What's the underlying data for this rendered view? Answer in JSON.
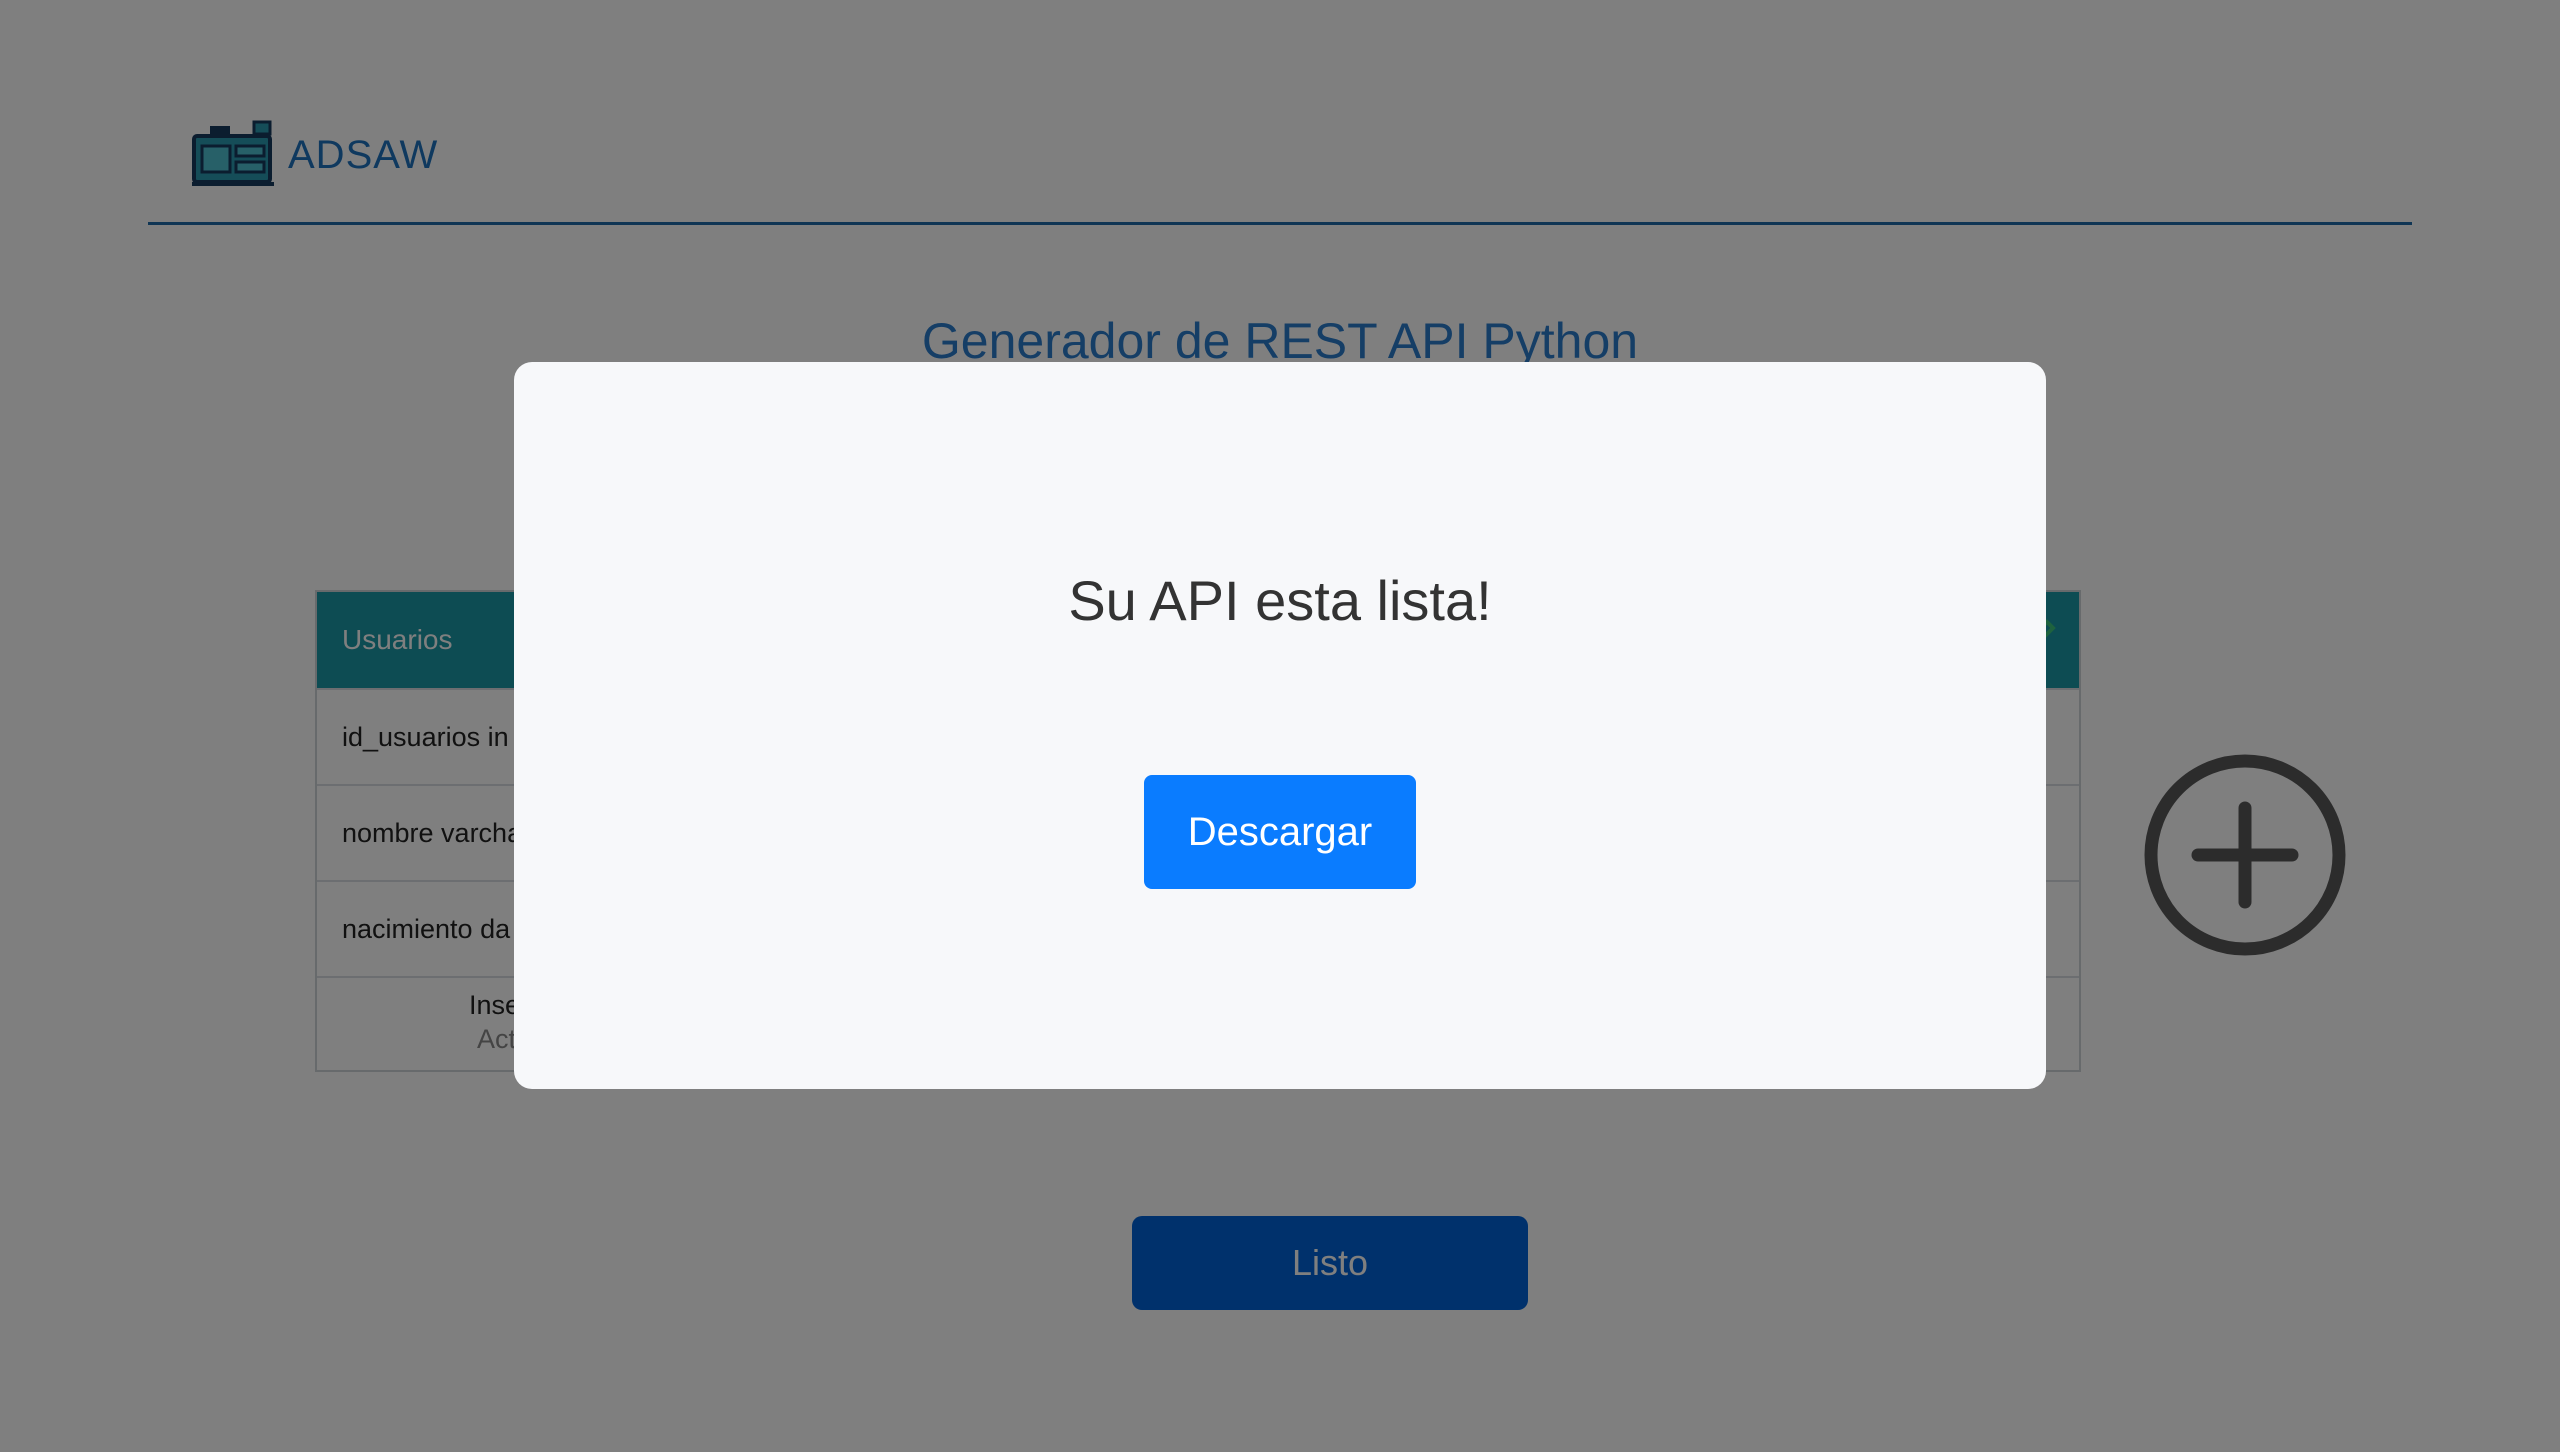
{
  "header": {
    "brand": "ADSAW",
    "logo_icon": "server-icon"
  },
  "main": {
    "title": "Generador de REST API Python",
    "table": {
      "name": "Usuarios",
      "header_icon": "edit-icon",
      "rows": [
        "id_usuarios in",
        "nombre varcha",
        "nacimiento da"
      ],
      "footer_line1": "Inse",
      "footer_line2": "Act"
    },
    "add_icon": "plus-circle-icon",
    "done_label": "Listo"
  },
  "modal": {
    "message": "Su API esta lista!",
    "download_label": "Descargar"
  },
  "colors": {
    "brand": "#1e73be",
    "table_header": "#1a98a6",
    "primary_button": "#0a7cff",
    "done_button": "#0063d8",
    "overlay": "rgba(0,0,0,0.5)"
  }
}
